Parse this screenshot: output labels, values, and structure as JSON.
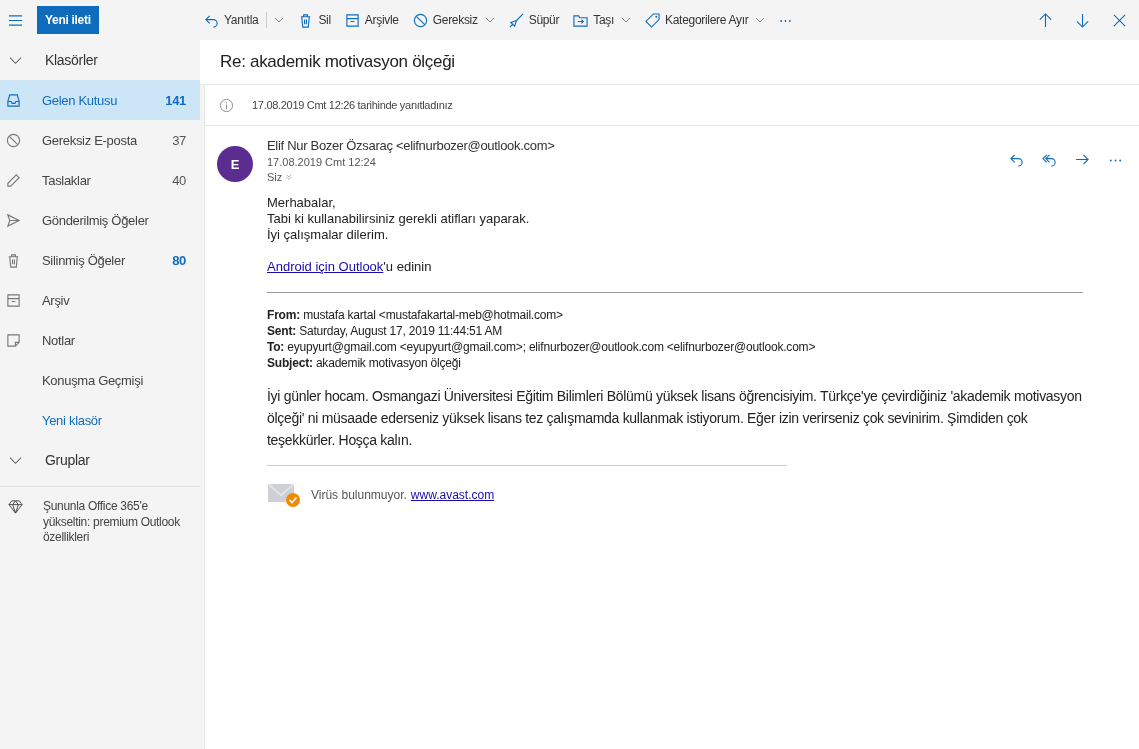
{
  "topbar": {
    "new_button": "Yeni ileti",
    "actions": [
      {
        "kind": "action",
        "label": "Yanıtla",
        "caret": true,
        "split": true
      },
      {
        "kind": "action",
        "label": "Sil",
        "caret": false,
        "split": false
      },
      {
        "kind": "action",
        "label": "Arşivle",
        "caret": false,
        "split": false
      },
      {
        "kind": "action",
        "label": "Gereksiz",
        "caret": true,
        "split": false
      },
      {
        "kind": "action",
        "label": "Süpür",
        "caret": false,
        "split": false
      },
      {
        "kind": "action",
        "label": "Taşı",
        "caret": true,
        "split": false
      },
      {
        "kind": "action",
        "label": "Kategorilere Ayır",
        "caret": true,
        "split": false
      },
      {
        "kind": "more",
        "label": "⋯"
      }
    ]
  },
  "sidebar": {
    "items": [
      {
        "kind": "header",
        "label": "Klasörler"
      },
      {
        "kind": "folder",
        "label": "Gelen Kutusu",
        "count": "141",
        "unread": true,
        "selected": true
      },
      {
        "kind": "folder",
        "label": "Gereksiz E-posta",
        "count": "37",
        "unread": false,
        "selected": false
      },
      {
        "kind": "folder",
        "label": "Taslaklar",
        "count": "40",
        "unread": false,
        "selected": false
      },
      {
        "kind": "folder",
        "label": "Gönderilmiş Öğeler",
        "selected": false
      },
      {
        "kind": "folder",
        "label": "Silinmiş Öğeler",
        "count": "80",
        "unread": true,
        "selected": false
      },
      {
        "kind": "folder",
        "label": "Arşiv",
        "selected": false
      },
      {
        "kind": "folder",
        "label": "Notlar",
        "selected": false
      },
      {
        "kind": "folder",
        "label": "Konuşma Geçmişi",
        "selected": false
      },
      {
        "kind": "link",
        "label": "Yeni klasör"
      },
      {
        "kind": "header",
        "label": "Gruplar"
      },
      {
        "kind": "promo",
        "label": "Şununla Office 365'e yükseltin: premium Outlook özellikleri"
      }
    ]
  },
  "message": {
    "subject": "Re: akademik motivasyon ölçeği",
    "info": "17.08.2019 Cmt 12:26 tarihinde yanıtladınız",
    "avatar": "E",
    "sender": "Elif Nur Bozer Özsaraç <elifnurbozer@outlook.com>",
    "date": "17.08.2019 Cmt 12:24",
    "recipient": "Siz",
    "body_lines": [
      "Merhabalar,",
      "Tabi ki kullanabilirsiniz gerekli atifları yaparak.",
      "İyi çalışmalar dilerim."
    ],
    "outlook_link": "Android için Outlook",
    "outlook_suffix": "'u edinin",
    "quoted_headers": [
      "**From:** mustafa kartal <mustafakartal-meb@hotmail.com>",
      "**Sent:** Saturday, August 17, 2019 11:44:51 AM",
      "**To:** eyupyurt@gmail.com <eyupyurt@gmail.com>; elifnurbozer@outlook.com <elifnurbozer@outlook.com>",
      "**Subject:** akademik motivasyon ölçeği"
    ],
    "quoted_body": "İyi günler hocam. Osmangazi Üniversitesi Eğitim Bilimleri Bölümü yüksek lisans öğrencisiyim. Türkçe'ye çevirdiğiniz 'akademik motivasyon ölçeği' ni  müsaade ederseniz yüksek lisans tez çalışmamda kullanmak istiyorum. Eğer izin verirseniz çok sevinirim. Şimdiden çok teşekkürler. Hoşça kalın.",
    "virus_text": "Virüs bulunmuyor.",
    "virus_link": "www.avast.com"
  }
}
